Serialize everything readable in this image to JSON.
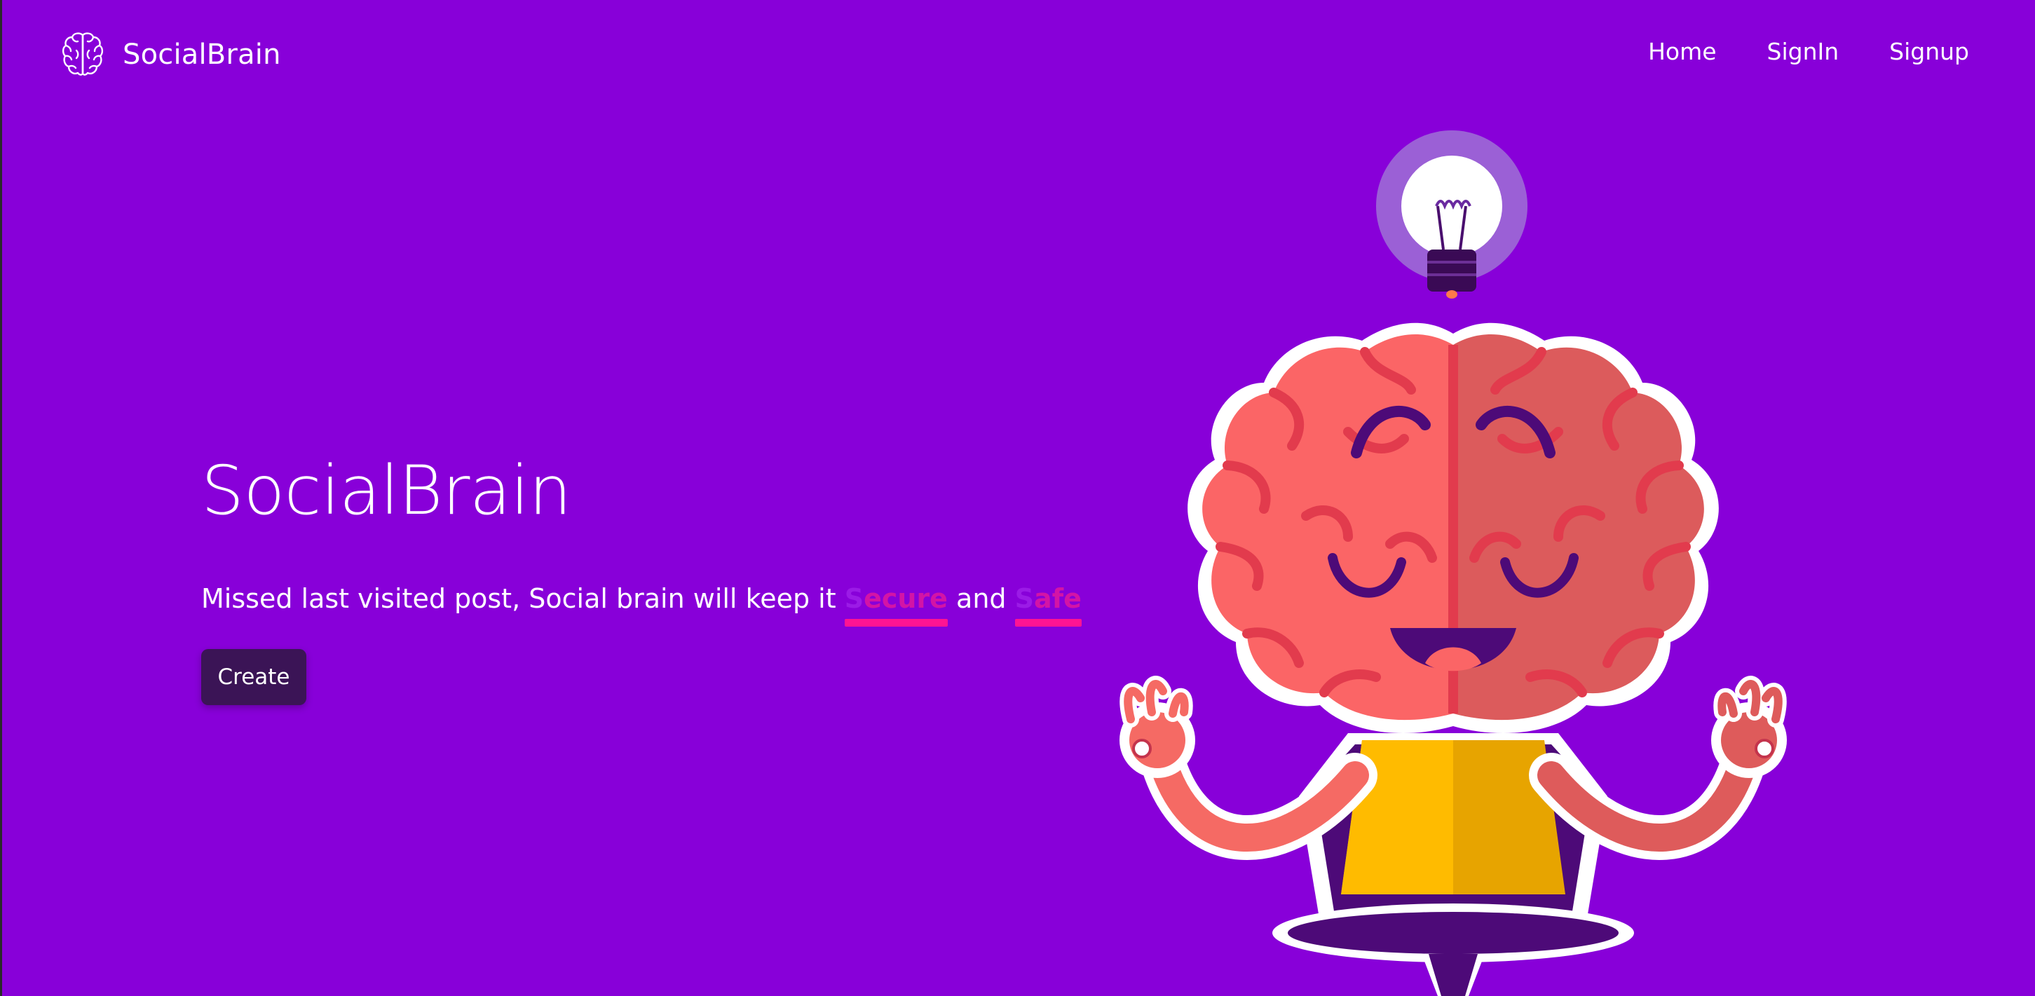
{
  "brand": {
    "name": "SocialBrain",
    "icon": "brain-outline-icon"
  },
  "nav": {
    "items": [
      {
        "label": "Home"
      },
      {
        "label": "SignIn"
      },
      {
        "label": "Signup"
      }
    ]
  },
  "hero": {
    "title": "SocialBrain",
    "subtitle_prefix": "Missed last visited post, Social brain will keep it ",
    "highlight1_first": "S",
    "highlight1_rest": "ecure",
    "connector": " and ",
    "highlight2_first": "S",
    "highlight2_rest": "afe",
    "create_label": "Create"
  },
  "illustration": {
    "icon": "meditating-brain-with-lightbulb-illustration"
  },
  "colors": {
    "background": "#8800d9",
    "button": "#3b1456",
    "highlight_text": "#d314a6",
    "highlight_underline": "#ff1493"
  }
}
